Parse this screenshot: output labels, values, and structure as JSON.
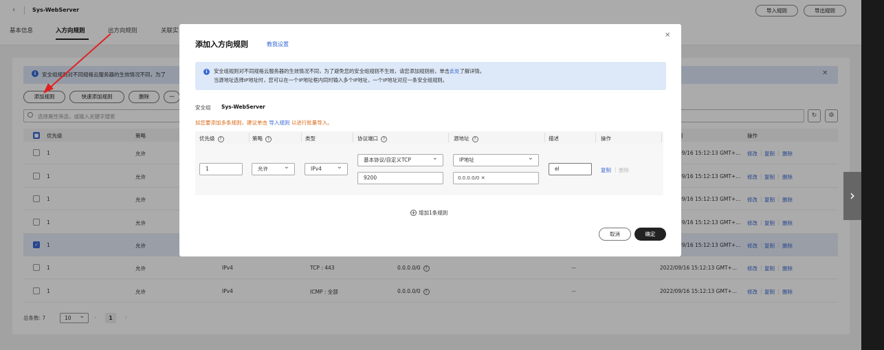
{
  "header": {
    "title": "Sys-WebServer",
    "import_button": "导入规则",
    "export_button": "导出规则"
  },
  "tabs": [
    {
      "label": "基本信息"
    },
    {
      "label": "入方向规则"
    },
    {
      "label": "出方向规则"
    },
    {
      "label": "关联实"
    }
  ],
  "alert": {
    "text": "安全组规则对不同规格云服务器的生效情况不同，为了"
  },
  "toolbar": {
    "add": "添加规则",
    "quick_add": "快速添加规则",
    "delete": "删除",
    "more": "一"
  },
  "search": {
    "placeholder": "选择属性筛选，或输入关键字搜索"
  },
  "table": {
    "headers": {
      "priority": "优先级",
      "policy": "策略",
      "time": "间",
      "ops": "操作"
    },
    "rows": [
      {
        "priority": "1",
        "policy": "允许",
        "type": "",
        "port": "",
        "source": "",
        "desc": "",
        "time": "09/16 15:12:13 GMT+...",
        "checked": false
      },
      {
        "priority": "1",
        "policy": "允许",
        "type": "",
        "port": "",
        "source": "",
        "desc": "",
        "time": "09/16 15:12:13 GMT+...",
        "checked": false
      },
      {
        "priority": "1",
        "policy": "允许",
        "type": "",
        "port": "",
        "source": "",
        "desc": "",
        "time": "09/16 15:12:13 GMT+...",
        "checked": false
      },
      {
        "priority": "1",
        "policy": "允许",
        "type": "",
        "port": "",
        "source": "",
        "desc": "",
        "time": "09/16 15:12:13 GMT+...",
        "checked": false
      },
      {
        "priority": "1",
        "policy": "允许",
        "type": "",
        "port": "",
        "source": "",
        "desc": "",
        "time": "09/16 15:12:13 GMT+...",
        "checked": true
      },
      {
        "priority": "1",
        "policy": "允许",
        "type": "IPv4",
        "port": "TCP : 443",
        "source": "0.0.0.0/0",
        "desc": "--",
        "time": "2022/09/16 15:12:13 GMT+...",
        "checked": false
      },
      {
        "priority": "1",
        "policy": "允许",
        "type": "IPv4",
        "port": "ICMP : 全部",
        "source": "0.0.0.0/0",
        "desc": "--",
        "time": "2022/09/16 15:12:13 GMT+...",
        "checked": false
      }
    ],
    "op_modify": "修改",
    "op_copy": "复制",
    "op_delete": "删除"
  },
  "pager": {
    "total_label": "总条数: 7",
    "page_size": "10",
    "current_page": "1"
  },
  "modal": {
    "title": "添加入方向规则",
    "help_link": "教我设置",
    "alert_line1_a": "安全组规则对不同规格云服务器的生效情况不同，为了避免您的安全组规则不生效，请您添加规则前，单击",
    "alert_line1_link": "此处",
    "alert_line1_b": "了解详情。",
    "alert_line2": "当源地址选择IP地址时，您可以在一个IP地址框内同时输入多个IP地址，一个IP地址对应一条安全组规则。",
    "sg_label": "安全组",
    "sg_name": "Sys-WebServer",
    "tip_a": "如您要添加多条规则，建议单击",
    "tip_link": "导入规则",
    "tip_b": "以进行批量导入。",
    "headers": {
      "priority": "优先级",
      "policy": "策略",
      "type": "类型",
      "port": "协议端口",
      "source": "源地址",
      "desc": "描述",
      "ops": "操作"
    },
    "row": {
      "priority": "1",
      "policy": "允许",
      "type": "IPv4",
      "protocol": "基本协议/自定义TCP",
      "port": "9200",
      "source_type": "IP地址",
      "source_value": "0.0.0.0/0",
      "desc": "el",
      "copy": "复制",
      "delete": "删除"
    },
    "add_row": "增加1条规则",
    "cancel": "取消",
    "ok": "确定"
  }
}
